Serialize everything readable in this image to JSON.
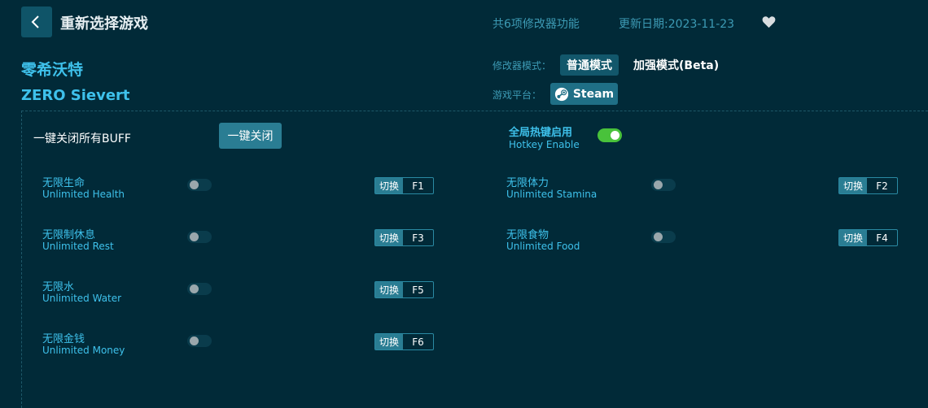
{
  "header": {
    "title": "重新选择游戏",
    "feature_count": "共6项修改器功能",
    "update_date": "更新日期:2023-11-23"
  },
  "game": {
    "name_cn": "零希沃特",
    "name_en": "ZERO Sievert"
  },
  "mode": {
    "label": "修改器模式：",
    "normal": "普通模式",
    "enhanced": "加强模式(Beta)"
  },
  "platform": {
    "label": "游戏平台：",
    "name": "Steam",
    "icon": "steam-icon"
  },
  "controls": {
    "close_all_label": "一键关闭所有BUFF",
    "close_all_button": "一键关闭",
    "hotkey_cn": "全局热键启用",
    "hotkey_en": "Hotkey Enable",
    "hotkey_enabled": true
  },
  "cheats": [
    {
      "name_cn": "无限生命",
      "name_en": "Unlimited Health",
      "switch": "切换",
      "key": "F1",
      "enabled": false
    },
    {
      "name_cn": "无限体力",
      "name_en": "Unlimited Stamina",
      "switch": "切换",
      "key": "F2",
      "enabled": false
    },
    {
      "name_cn": "无限制休息",
      "name_en": "Unlimited Rest",
      "switch": "切换",
      "key": "F3",
      "enabled": false
    },
    {
      "name_cn": "无限食物",
      "name_en": "Unlimited Food",
      "switch": "切换",
      "key": "F4",
      "enabled": false
    },
    {
      "name_cn": "无限水",
      "name_en": "Unlimited Water",
      "switch": "切换",
      "key": "F5",
      "enabled": false
    },
    {
      "name_cn": "无限金钱",
      "name_en": "Unlimited Money",
      "switch": "切换",
      "key": "F6",
      "enabled": false
    }
  ],
  "colors": {
    "background": "#012a38",
    "accent": "#3ec1eb",
    "button": "#2a7d93",
    "toggle_on": "#49c23b"
  }
}
